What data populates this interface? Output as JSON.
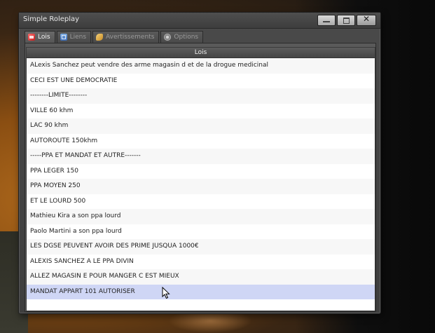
{
  "window": {
    "title": "Simple Roleplay",
    "controls": {
      "minimize": "",
      "maximize": "",
      "close": "✕"
    }
  },
  "tabs": [
    {
      "label": "Lois",
      "icon": "law-icon",
      "active": true
    },
    {
      "label": "Liens",
      "icon": "link-icon",
      "active": false
    },
    {
      "label": "Avertissements",
      "icon": "warning-icon",
      "active": false
    },
    {
      "label": "Options",
      "icon": "gear-icon",
      "active": false
    }
  ],
  "list": {
    "column_header": "Lois",
    "rows": [
      "ALexis Sanchez peut vendre des arme magasin d et de la drogue medicinal",
      "CECI EST UNE DEMOCRATIE",
      "--------LIMITE--------",
      "VILLE 60 khm",
      "LAC 90 khm",
      "AUTOROUTE 150khm",
      "-----PPA ET MANDAT ET AUTRE-------",
      "PPA LEGER 150",
      "PPA MOYEN 250",
      "ET LE LOURD 500",
      "Mathieu Kira a son ppa lourd",
      "Paolo Martini a son ppa lourd",
      "LES DGSE PEUVENT AVOIR DES PRIME JUSQUA 1000€",
      "ALEXIS SANCHEZ A LE PPA DIVIN",
      "ALLEZ MAGASIN E POUR MANGER C EST MIEUX",
      "MANDAT APPART 101 AUTORISER"
    ],
    "selected_index": 15
  }
}
